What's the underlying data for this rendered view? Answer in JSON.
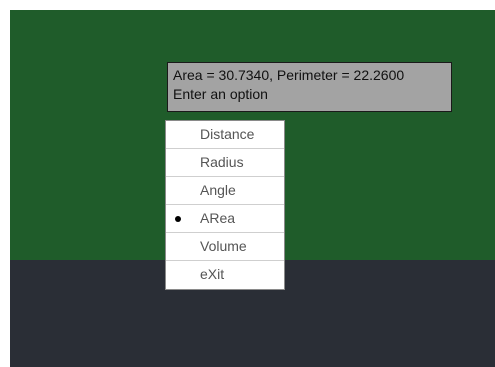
{
  "prompt": {
    "line1": "Area = 30.7340, Perimeter = 22.2600",
    "line2": "Enter an option"
  },
  "menu": {
    "items": [
      {
        "label": "Distance",
        "selected": false
      },
      {
        "label": "Radius",
        "selected": false
      },
      {
        "label": "Angle",
        "selected": false
      },
      {
        "label": "ARea",
        "selected": true
      },
      {
        "label": "Volume",
        "selected": false
      },
      {
        "label": "eXit",
        "selected": false
      }
    ]
  },
  "colors": {
    "drawing_background": "#1f5c2a",
    "lower_background": "#2a2e36",
    "tooltip_background": "#a3a3a3",
    "menu_background": "#ffffff"
  }
}
